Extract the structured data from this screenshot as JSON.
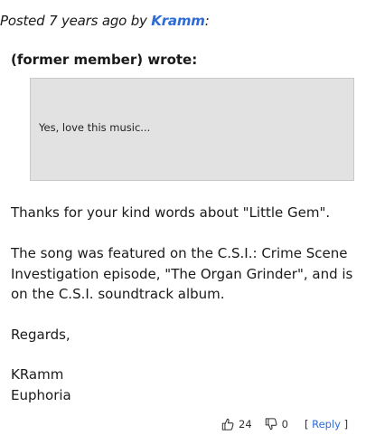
{
  "post": {
    "posted_prefix": "Posted",
    "age": "7 years ago",
    "by": "by",
    "author": "Kramm",
    "colon": ":"
  },
  "quote": {
    "header": "(former member) wrote:",
    "text": "Yes, love this music..."
  },
  "body": {
    "p1": "Thanks for your kind words about \"Little Gem\".",
    "p2": "The song was featured on the C.S.I.: Crime Scene Investigation episode, \"The Organ Grinder\", and is on the C.S.I. soundtrack album.",
    "p3": "Regards,",
    "p4_line1": "KRamm",
    "p4_line2": "Euphoria"
  },
  "footer": {
    "likes": "24",
    "dislikes": "0",
    "bracket_open": "[",
    "reply_label": "Reply",
    "bracket_close": "]"
  },
  "colors": {
    "link": "#2e6bd6",
    "quote_bg": "#e2e2e2"
  },
  "icons": {
    "like": "thumbs-up-icon",
    "dislike": "thumbs-down-icon"
  }
}
